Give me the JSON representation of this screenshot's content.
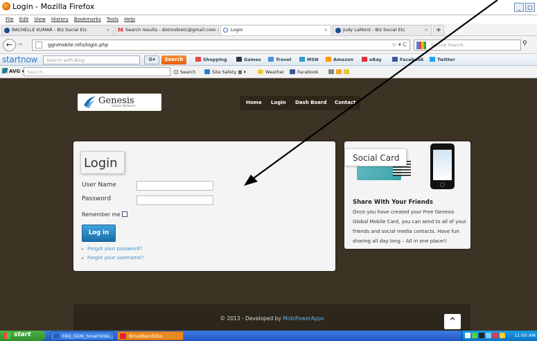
{
  "window": {
    "title": "Login - Mozilla Firefox",
    "controls": [
      "_",
      "□"
    ]
  },
  "menu": [
    "File",
    "Edit",
    "View",
    "History",
    "Bookmarks",
    "Tools",
    "Help"
  ],
  "tabs": [
    {
      "label": "RACHELLE KUMAR - Biz Social Etc",
      "icon": "tab-site-icon"
    },
    {
      "label": "Search results - dotmobietc@gmail.com - ...",
      "icon": "gmail-icon"
    },
    {
      "label": "Login",
      "icon": "search-icon",
      "active": true
    },
    {
      "label": "Judy LaMont - Biz Social Etc",
      "icon": "tab-site-icon"
    }
  ],
  "nav": {
    "url": "ggnmobile.info/login.php",
    "search_placeholder": "Secure Search",
    "star": "☆ ▾ C"
  },
  "startnow": {
    "logo": "startnow",
    "search_placeholder": "Search with Bing",
    "search_button": "Search",
    "links": [
      "Shopping",
      "Games",
      "Travel",
      "MSN",
      "Amazon",
      "eBay",
      "Facebook",
      "Twitter"
    ]
  },
  "avg": {
    "label": "AVG",
    "search_placeholder": "Search...",
    "links": [
      "Search",
      "Site Safety",
      "Weather",
      "Facebook"
    ]
  },
  "site": {
    "logo_name": "Genesis",
    "logo_sub": "Global Network",
    "nav": [
      "Home",
      "Login",
      "Dash Board",
      "Contact"
    ],
    "login": {
      "title": "Login",
      "username_label": "User Name",
      "password_label": "Password",
      "remember_label": "Remember me",
      "button": "Log in",
      "forgot_password": "Forgot your password?",
      "forgot_username": "Forgot your username?"
    },
    "card": {
      "label": "Social Card",
      "heading": "Share With Your Friends",
      "text": "Once you have created your Free Genesis Global Mobile Card, you can send to all of your friends and social media contacts. Have fun sharing all day long – All in one place!!"
    },
    "footer": {
      "prefix": "© 2013 - Developed by ",
      "link": "MobiPowerApps"
    },
    "to_top": "^"
  },
  "taskbar": {
    "start": "start",
    "items": [
      "FAQ_GGN_SmartVide...",
      "Broadband2Go"
    ],
    "time": "11:00 AM"
  },
  "colors": {
    "page_bg": "#3d3324",
    "accent_blue": "#1a6da9",
    "link_blue": "#3a8fd0",
    "startnow_orange": "#f2741f"
  }
}
